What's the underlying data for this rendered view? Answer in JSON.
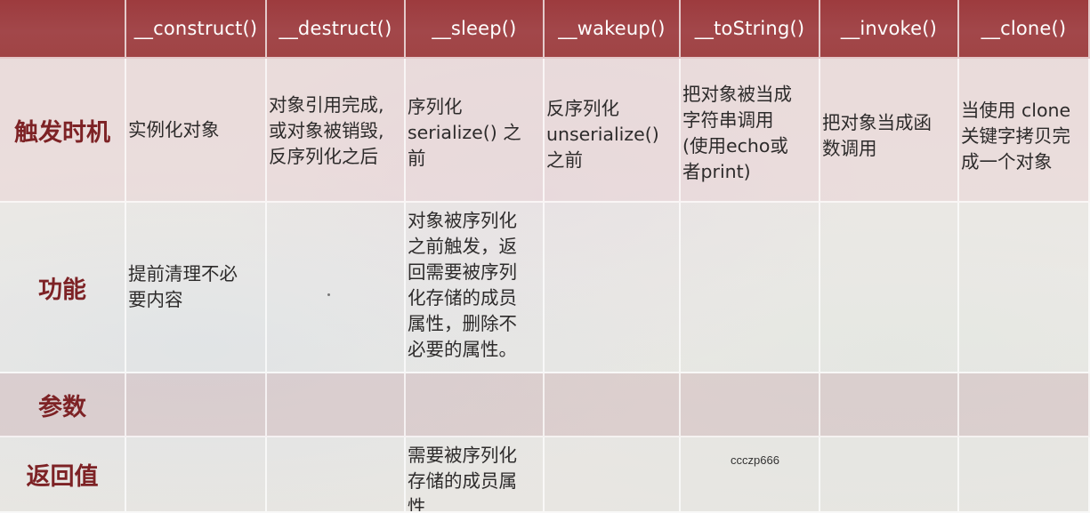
{
  "header": {
    "columns": [
      "",
      "__construct()",
      "__destruct()",
      "__sleep()",
      "__wakeup()",
      "__toString()",
      "__invoke()",
      "__clone()"
    ]
  },
  "rows": [
    {
      "label": "触发时机",
      "cells": [
        "实例化对象",
        "对象引用完成,\n或对象被销毁,\n反序列化之后",
        "序列化\nserialize() 之\n前",
        "反序列化\nunserialize()\n之前",
        "把对象被当成\n字符串调用\n(使用echo或\n者print)",
        "把对象当成函\n数调用",
        "当使用 clone\n关键字拷贝完\n成一个对象"
      ]
    },
    {
      "label": "功能",
      "cells": [
        "提前清理不必\n要内容",
        "",
        "对象被序列化\n之前触发，返\n回需要被序列\n化存储的成员\n属性，删除不\n必要的属性。",
        "",
        "",
        "",
        ""
      ]
    },
    {
      "label": "参数",
      "cells": [
        "",
        "",
        "",
        "",
        "",
        "",
        ""
      ]
    },
    {
      "label": "返回值",
      "cells": [
        "",
        "",
        "需要被序列化\n存储的成员属\n性",
        "",
        "",
        "",
        ""
      ]
    }
  ],
  "watermark": "ccczp666",
  "colors": {
    "header_bg": "#a04445",
    "header_text": "#ffffff",
    "row_label_text": "#7d2225",
    "body_text": "#2d2b2b"
  }
}
